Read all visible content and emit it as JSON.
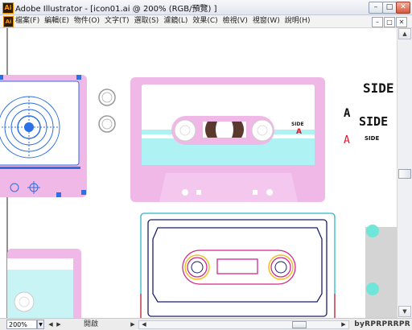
{
  "window": {
    "app_icon": "Ai",
    "title": "Adobe Illustrator - [icon01.ai @ 200% (RGB/預覽) ]",
    "buttons": {
      "minimize": "–",
      "restore": "□",
      "close": "✕"
    }
  },
  "menubar": {
    "doc_icon": "Ai",
    "items": [
      "檔案(F)",
      "編輯(E)",
      "物件(O)",
      "文字(T)",
      "選取(S)",
      "濾鏡(L)",
      "效果(C)",
      "檢視(V)",
      "視窗(W)",
      "說明(H)"
    ],
    "mdi_buttons": {
      "minimize": "–",
      "restore": "□",
      "close": "✕"
    }
  },
  "canvas": {
    "side_label_large": "SIDE",
    "label_a_black": "A",
    "side_label_medium": "SIDE",
    "label_a_red": "A",
    "side_label_small": "SIDE",
    "cassette_side_label": "SIDE",
    "cassette_side_letter": "A",
    "colors": {
      "pink": "#f0b8e6",
      "cyan": "#aef2f4",
      "red": "#e0142a",
      "blue_selection": "#2c6fe6",
      "outline_cyan": "#2ab6c8",
      "outline_magenta": "#d0288c",
      "outline_yellow": "#f0c020",
      "outline_navy": "#1a1f6e",
      "grey_panel": "#d4d4d4",
      "teal_dot": "#6ee6d8"
    }
  },
  "statusbar": {
    "zoom": "200%",
    "zoom_arrow": "▼",
    "nav_prev": "◀",
    "nav_next": "▶",
    "status": "開啟",
    "status_arrow": "▶",
    "hscroll_left": "◀",
    "hscroll_right": "▶",
    "watermark": "byRPRPRRPR"
  },
  "scrollbar": {
    "up": "▲",
    "down": "▼"
  }
}
